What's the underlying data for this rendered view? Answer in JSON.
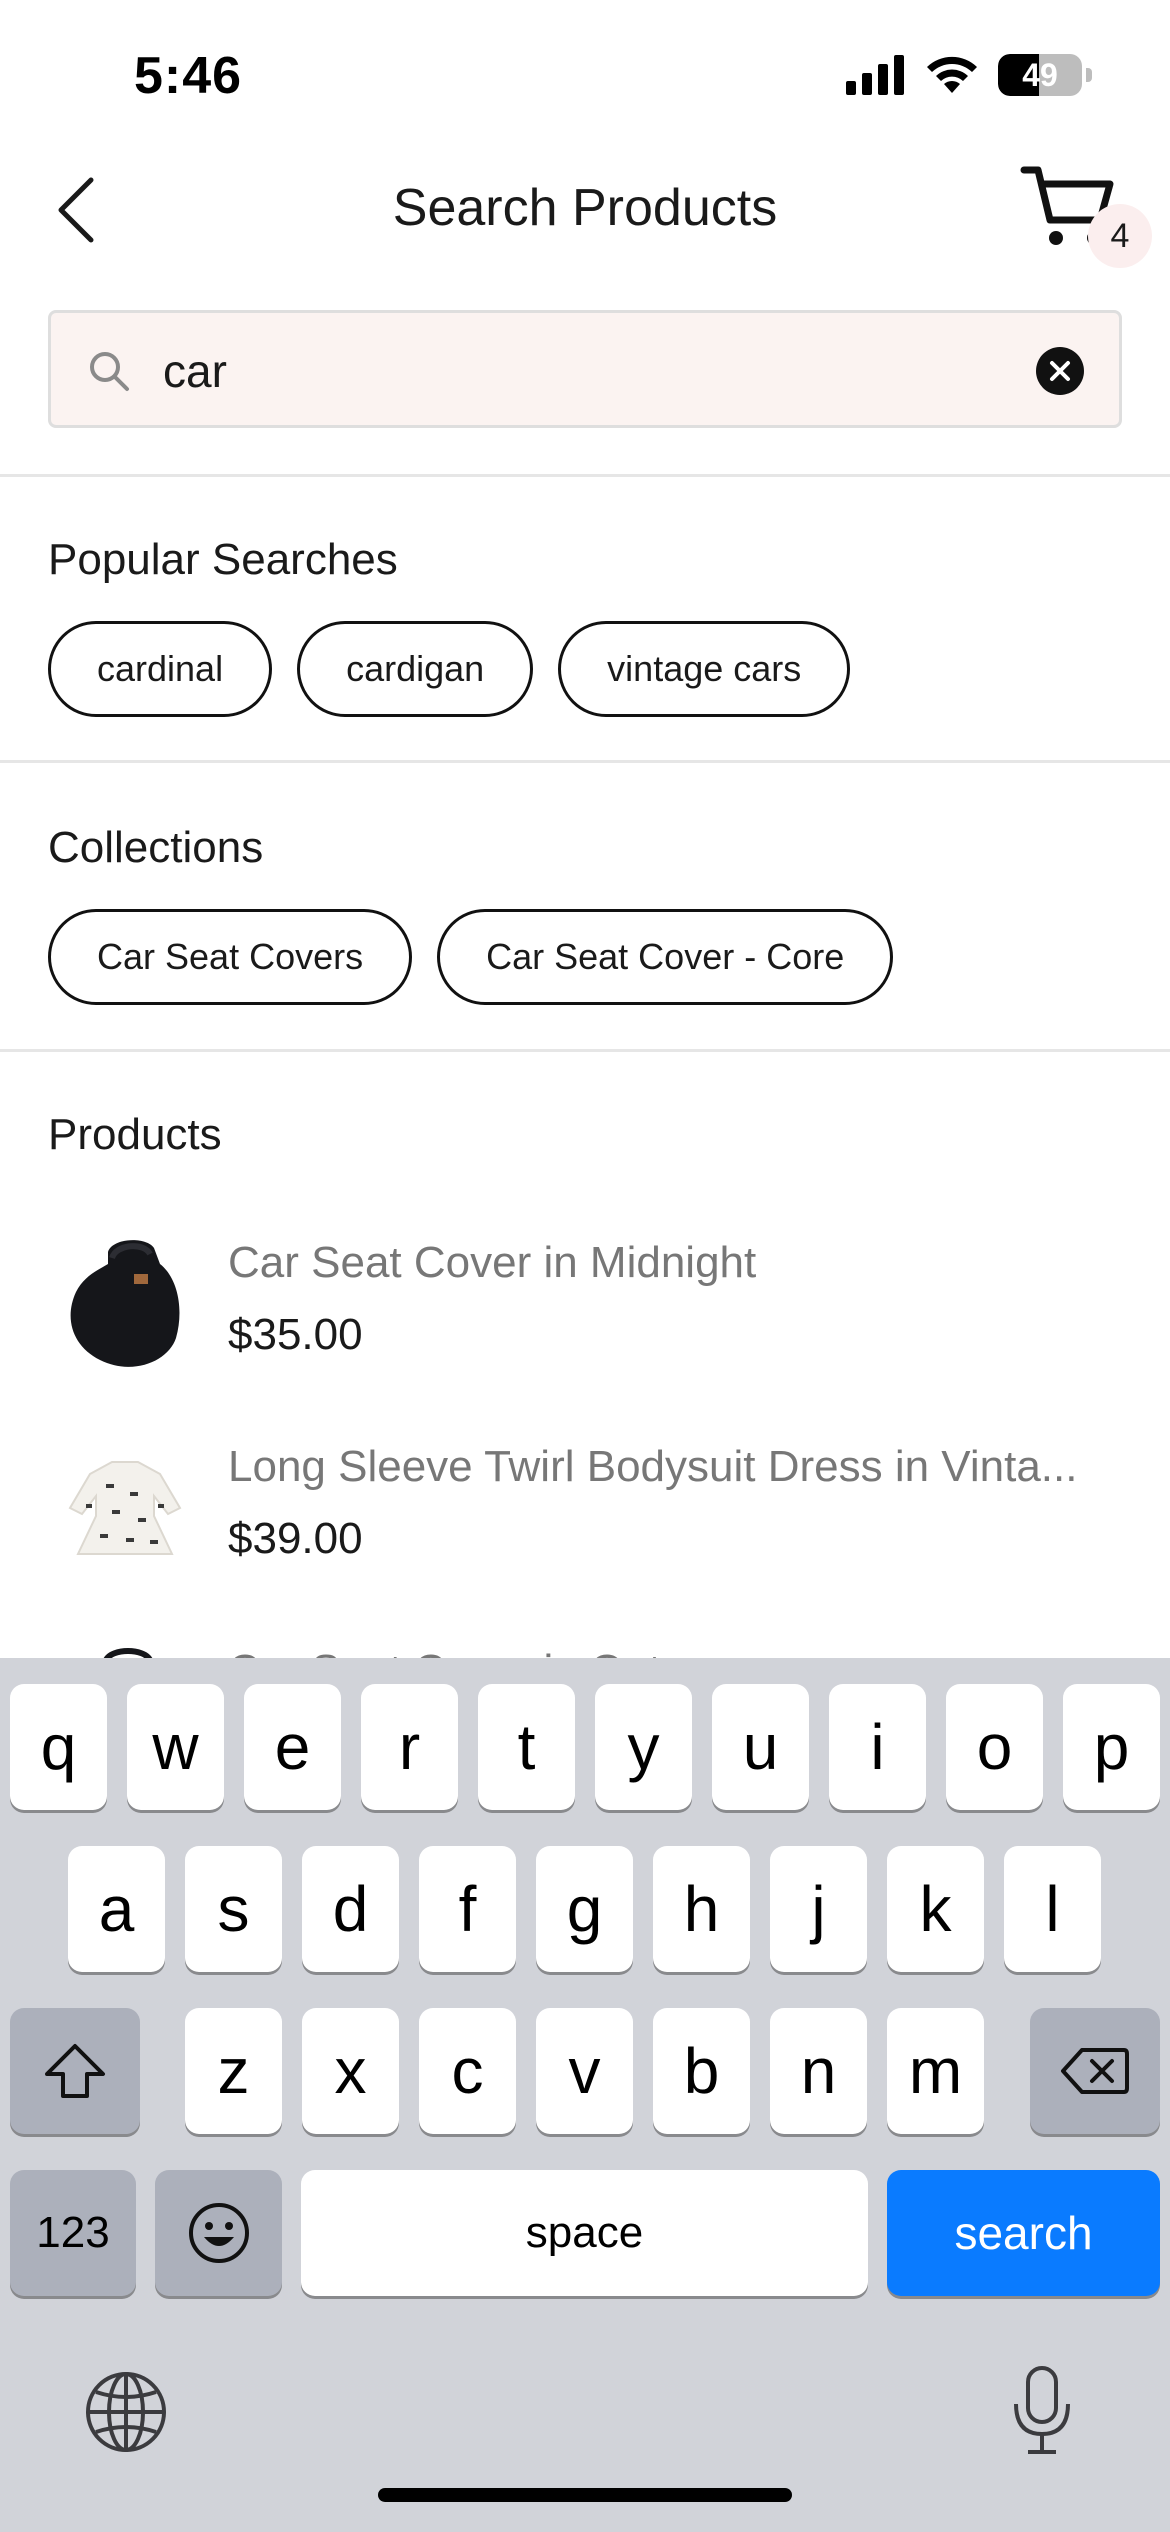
{
  "status_bar": {
    "time": "5:46",
    "battery_level": 49,
    "battery_label": "49",
    "icons": [
      "signal-icon",
      "wifi-icon",
      "battery-icon"
    ]
  },
  "nav": {
    "title": "Search Products",
    "cart_count": "4",
    "icons": [
      "back-chevron-icon",
      "cart-icon"
    ]
  },
  "search": {
    "value": "car",
    "placeholder": ""
  },
  "popular_searches": {
    "title": "Popular Searches",
    "items": [
      "cardinal",
      "cardigan",
      "vintage cars"
    ]
  },
  "collections": {
    "title": "Collections",
    "items": [
      "Car Seat Covers",
      "Car Seat Cover - Core"
    ]
  },
  "products": {
    "title": "Products",
    "items": [
      {
        "name": "Car Seat Cover in Midnight",
        "price": "$35.00"
      },
      {
        "name": "Long Sleeve Twirl Bodysuit Dress in Vinta...",
        "price": "$39.00"
      },
      {
        "name": "Car Seat Cover in Oat",
        "price": ""
      }
    ]
  },
  "keyboard": {
    "row1": [
      "q",
      "w",
      "e",
      "r",
      "t",
      "y",
      "u",
      "i",
      "o",
      "p"
    ],
    "row2": [
      "a",
      "s",
      "d",
      "f",
      "g",
      "h",
      "j",
      "k",
      "l"
    ],
    "row3": [
      "z",
      "x",
      "c",
      "v",
      "b",
      "n",
      "m"
    ],
    "numbers_label": "123",
    "space_label": "space",
    "action_label": "search",
    "action_color": "#0a7bff"
  }
}
